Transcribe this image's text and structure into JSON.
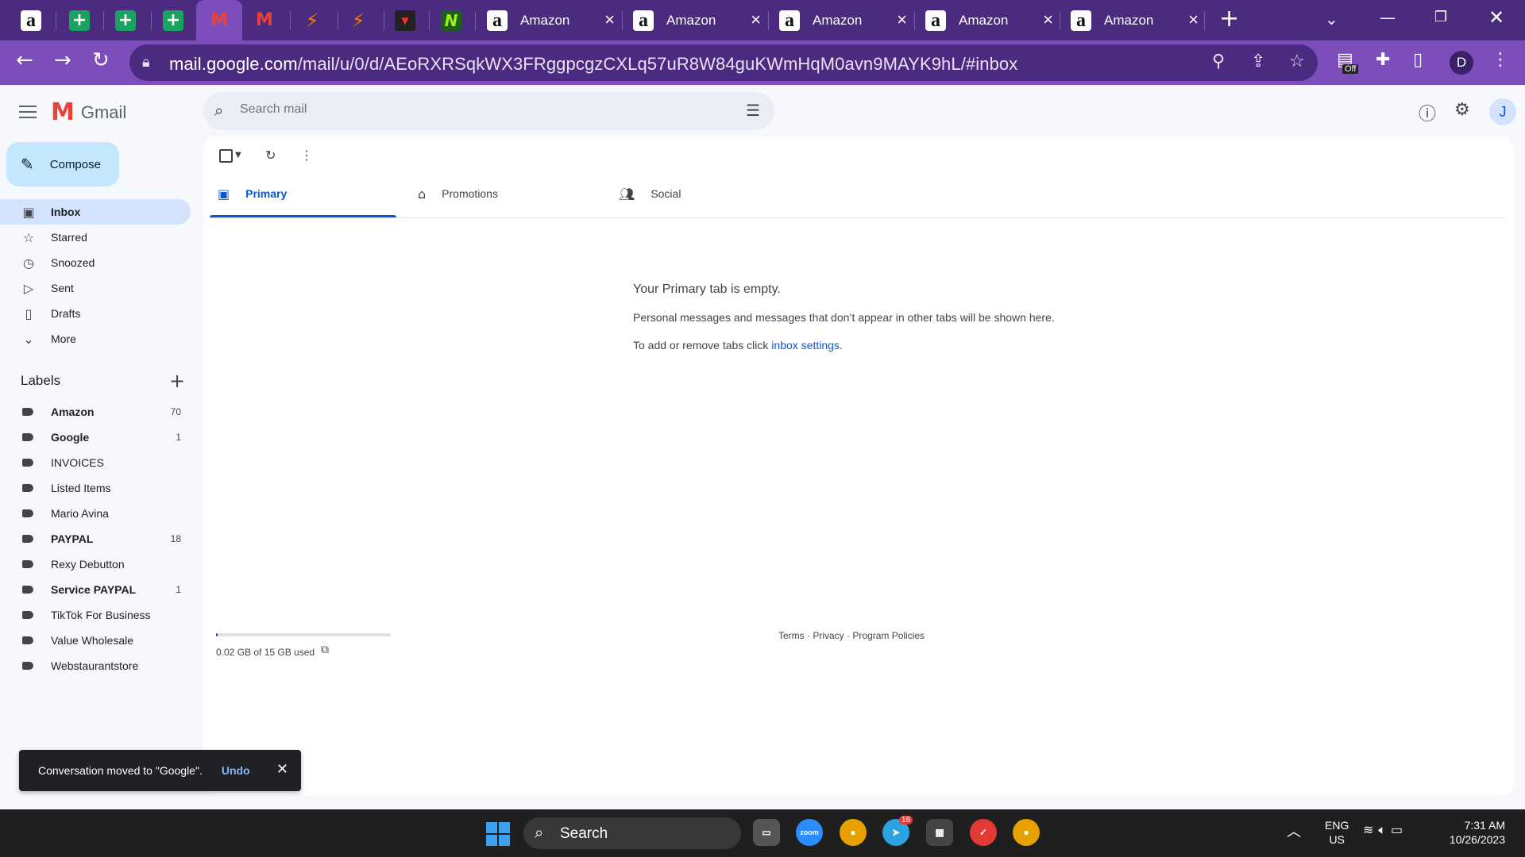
{
  "browser": {
    "tabs": [
      {
        "favicon": "amazon-favicon",
        "title": ""
      },
      {
        "favicon": "sheets-favicon",
        "title": ""
      },
      {
        "favicon": "sheets-favicon",
        "title": ""
      },
      {
        "favicon": "sheets-favicon",
        "title": ""
      },
      {
        "favicon": "gmail-favicon",
        "title": "",
        "active": true
      },
      {
        "favicon": "gmail-favicon",
        "title": ""
      },
      {
        "favicon": "orange-app-favicon",
        "title": ""
      },
      {
        "favicon": "orange-app-favicon",
        "title": ""
      },
      {
        "favicon": "red-app-favicon",
        "title": ""
      },
      {
        "favicon": "green-app-favicon",
        "title": ""
      },
      {
        "favicon": "amazon-favicon",
        "title": "Amazon"
      },
      {
        "favicon": "amazon-favicon",
        "title": "Amazon"
      },
      {
        "favicon": "amazon-favicon",
        "title": "Amazon"
      },
      {
        "favicon": "amazon-favicon",
        "title": "Amazon"
      },
      {
        "favicon": "amazon-favicon",
        "title": "Amazon"
      }
    ],
    "url_host": "mail.google.com",
    "url_path": "/mail/u/0/d/AEoRXRSqkWX3FRggpcgzCXLq57uR8W84guKWmHqM0avn9MAYK9hL/#inbox",
    "extension_badge": "Off",
    "profile_initial": "D",
    "theme_color": "#7c4dbb"
  },
  "gmail": {
    "logo_text": "Gmail",
    "search_placeholder": "Search mail",
    "account_initial": "J",
    "compose_label": "Compose",
    "nav": [
      {
        "label": "Inbox",
        "icon": "inbox-icon",
        "active": true
      },
      {
        "label": "Starred",
        "icon": "star-icon"
      },
      {
        "label": "Snoozed",
        "icon": "clock-icon"
      },
      {
        "label": "Sent",
        "icon": "send-icon"
      },
      {
        "label": "Drafts",
        "icon": "draft-icon"
      },
      {
        "label": "More",
        "icon": "chevron-down-icon"
      }
    ],
    "labels_heading": "Labels",
    "labels": [
      {
        "name": "Amazon",
        "count": "70",
        "bold": true
      },
      {
        "name": "Google",
        "count": "1",
        "bold": true
      },
      {
        "name": "INVOICES",
        "count": "",
        "bold": false
      },
      {
        "name": "Listed Items",
        "count": "",
        "bold": false
      },
      {
        "name": "Mario Avina",
        "count": "",
        "bold": false
      },
      {
        "name": "PAYPAL",
        "count": "18",
        "bold": true
      },
      {
        "name": "Rexy Debutton",
        "count": "",
        "bold": false
      },
      {
        "name": "Service PAYPAL",
        "count": "1",
        "bold": true
      },
      {
        "name": "TikTok For Business",
        "count": "",
        "bold": false
      },
      {
        "name": "Value Wholesale",
        "count": "",
        "bold": false
      },
      {
        "name": "Webstaurantstore",
        "count": "",
        "bold": false
      }
    ],
    "category_tabs": [
      {
        "label": "Primary",
        "icon": "inbox-icon",
        "active": true
      },
      {
        "label": "Promotions",
        "icon": "tag-icon"
      },
      {
        "label": "Social",
        "icon": "people-icon"
      }
    ],
    "empty_state": {
      "title": "Your Primary tab is empty.",
      "body": "Personal messages and messages that don’t appear in other tabs will be shown here.",
      "settings_prefix": "To add or remove tabs click ",
      "settings_link": "inbox settings",
      "settings_suffix": "."
    },
    "storage": {
      "text": "0.02 GB of 15 GB used",
      "fraction": 0.0013
    },
    "footer": {
      "terms": "Terms",
      "privacy": "Privacy",
      "policies": "Program Policies",
      "sep": " · "
    },
    "snackbar": {
      "message": "Conversation moved to \"Google\".",
      "action": "Undo"
    }
  },
  "taskbar": {
    "search_label": "Search",
    "telegram_badge": "18",
    "lang_top": "ENG",
    "lang_bottom": "US",
    "time": "7:31 AM",
    "date": "10/26/2023",
    "apps": [
      "file-explorer-icon",
      "zoom-icon",
      "chrome-icon",
      "telegram-icon",
      "calculator-icon",
      "tasks-icon",
      "chrome-profile-icon"
    ]
  }
}
